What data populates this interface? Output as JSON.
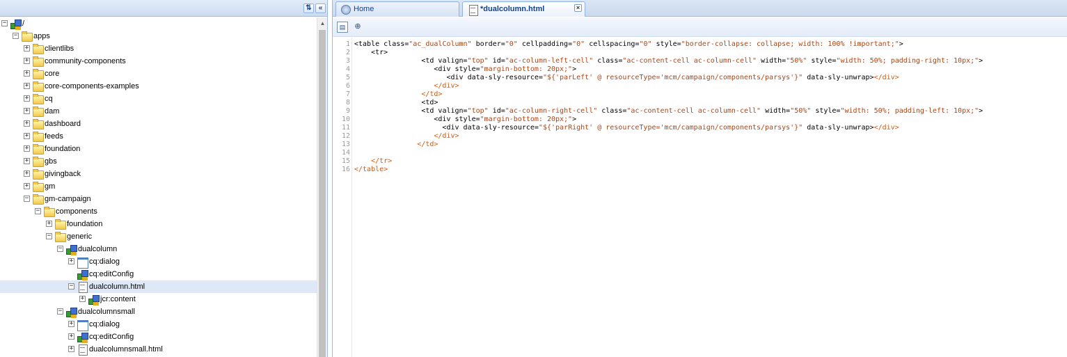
{
  "left_panel": {
    "tools": [
      {
        "icon": "sync-tree-icon"
      },
      {
        "icon": "collapse-panel-icon"
      }
    ],
    "tree": [
      {
        "label": "/",
        "depth": 0,
        "state": "expanded",
        "icon": "component-icon"
      },
      {
        "label": "apps",
        "depth": 1,
        "state": "expanded",
        "icon": "folder-icon"
      },
      {
        "label": "clientlibs",
        "depth": 2,
        "state": "collapsed",
        "icon": "folder-icon"
      },
      {
        "label": "community-components",
        "depth": 2,
        "state": "collapsed",
        "icon": "folder-icon"
      },
      {
        "label": "core",
        "depth": 2,
        "state": "collapsed",
        "icon": "folder-icon"
      },
      {
        "label": "core-components-examples",
        "depth": 2,
        "state": "collapsed",
        "icon": "folder-icon"
      },
      {
        "label": "cq",
        "depth": 2,
        "state": "collapsed",
        "icon": "folder-icon"
      },
      {
        "label": "dam",
        "depth": 2,
        "state": "collapsed",
        "icon": "folder-icon"
      },
      {
        "label": "dashboard",
        "depth": 2,
        "state": "collapsed",
        "icon": "folder-icon"
      },
      {
        "label": "feeds",
        "depth": 2,
        "state": "collapsed",
        "icon": "folder-icon"
      },
      {
        "label": "foundation",
        "depth": 2,
        "state": "collapsed",
        "icon": "folder-icon"
      },
      {
        "label": "gbs",
        "depth": 2,
        "state": "collapsed",
        "icon": "folder-icon"
      },
      {
        "label": "givingback",
        "depth": 2,
        "state": "collapsed",
        "icon": "folder-icon"
      },
      {
        "label": "gm",
        "depth": 2,
        "state": "collapsed",
        "icon": "folder-icon"
      },
      {
        "label": "gm-campaign",
        "depth": 2,
        "state": "expanded",
        "icon": "folder-icon"
      },
      {
        "label": "components",
        "depth": 3,
        "state": "expanded",
        "icon": "folder-icon"
      },
      {
        "label": "foundation",
        "depth": 4,
        "state": "collapsed",
        "icon": "folder-icon"
      },
      {
        "label": "generic",
        "depth": 4,
        "state": "expanded",
        "icon": "folder-icon"
      },
      {
        "label": "dualcolumn",
        "depth": 5,
        "state": "expanded",
        "icon": "component-icon"
      },
      {
        "label": "cq:dialog",
        "depth": 6,
        "state": "collapsed",
        "icon": "dialog-icon"
      },
      {
        "label": "cq:editConfig",
        "depth": 6,
        "state": "none",
        "icon": "component-icon"
      },
      {
        "label": "dualcolumn.html",
        "depth": 6,
        "state": "expanded",
        "icon": "file-icon",
        "selected": true
      },
      {
        "label": "jcr:content",
        "depth": 7,
        "state": "collapsed",
        "icon": "component-icon"
      },
      {
        "label": "dualcolumnsmall",
        "depth": 5,
        "state": "expanded",
        "icon": "component-icon"
      },
      {
        "label": "cq:dialog",
        "depth": 6,
        "state": "collapsed",
        "icon": "dialog-icon"
      },
      {
        "label": "cq:editConfig",
        "depth": 6,
        "state": "collapsed",
        "icon": "component-icon"
      },
      {
        "label": "dualcolumnsmall.html",
        "depth": 6,
        "state": "collapsed",
        "icon": "file-icon"
      }
    ]
  },
  "tabs": [
    {
      "label": "Home",
      "icon": "home-icon",
      "active": false,
      "closable": false
    },
    {
      "label": "*dualcolumn.html",
      "icon": "file-icon",
      "active": true,
      "closable": true
    }
  ],
  "toolbar": {
    "buttons": [
      {
        "name": "save-button",
        "icon": "save-icon",
        "glyph": "💾"
      },
      {
        "name": "find-button",
        "icon": "binoculars-icon",
        "glyph": "🔭"
      }
    ]
  },
  "editor": {
    "lines": [
      [
        [
          "tg",
          "<table "
        ],
        [
          "at",
          "class="
        ],
        [
          "sv",
          "\"ac_dualColumn\""
        ],
        [
          "at",
          " border="
        ],
        [
          "sv",
          "\"0\""
        ],
        [
          "at",
          " cellpadding="
        ],
        [
          "sv",
          "\"0\""
        ],
        [
          "at",
          " cellspacing="
        ],
        [
          "sv",
          "\"0\""
        ],
        [
          "at",
          " style="
        ],
        [
          "sv",
          "\"border-collapse: collapse; width: 100% !important;\""
        ],
        [
          "tg",
          ">"
        ]
      ],
      [
        [
          "tg",
          "    <tr>"
        ]
      ],
      [
        [
          "tg",
          "                <td "
        ],
        [
          "at",
          "valign="
        ],
        [
          "sv",
          "\"top\""
        ],
        [
          "at",
          " id="
        ],
        [
          "sv",
          "\"ac-column-left-cell\""
        ],
        [
          "at",
          " class="
        ],
        [
          "sv",
          "\"ac-content-cell ac-column-cell\""
        ],
        [
          "at",
          " width="
        ],
        [
          "sv",
          "\"50%\""
        ],
        [
          "at",
          " style="
        ],
        [
          "sv",
          "\"width: 50%; padding-right: 10px;\""
        ],
        [
          "tg",
          ">"
        ]
      ],
      [
        [
          "tg",
          "                   <div "
        ],
        [
          "at",
          "style="
        ],
        [
          "sv",
          "\"margin-bottom: 20px;\""
        ],
        [
          "tg",
          ">"
        ]
      ],
      [
        [
          "tg",
          "                      <div "
        ],
        [
          "at",
          "data-sly-resource="
        ],
        [
          "sv",
          "\"${'parLeft' @ resourceType='mcm/campaign/components/parsys'}\""
        ],
        [
          "at",
          " data-sly-unwrap"
        ],
        [
          "tg",
          ">"
        ],
        [
          "ct",
          "</div>"
        ]
      ],
      [
        [
          "ct",
          "                   </div>"
        ]
      ],
      [
        [
          "ct",
          "                </td>"
        ]
      ],
      [
        [
          "tg",
          "                <td>"
        ]
      ],
      [
        [
          "tg",
          "                <td "
        ],
        [
          "at",
          "valign="
        ],
        [
          "sv",
          "\"top\""
        ],
        [
          "at",
          " id="
        ],
        [
          "sv",
          "\"ac-column-right-cell\""
        ],
        [
          "at",
          " class="
        ],
        [
          "sv",
          "\"ac-content-cell ac-column-cell\""
        ],
        [
          "at",
          " width="
        ],
        [
          "sv",
          "\"50%\""
        ],
        [
          "at",
          " style="
        ],
        [
          "sv",
          "\"width: 50%; padding-left: 10px;\""
        ],
        [
          "tg",
          ">"
        ]
      ],
      [
        [
          "tg",
          "                   <div "
        ],
        [
          "at",
          "style="
        ],
        [
          "sv",
          "\"margin-bottom: 20px;\""
        ],
        [
          "tg",
          ">"
        ]
      ],
      [
        [
          "tg",
          "                     <div "
        ],
        [
          "at",
          "data-sly-resource="
        ],
        [
          "sv",
          "\"${'parRight' @ resourceType='mcm/campaign/components/parsys'}\""
        ],
        [
          "at",
          " data-sly-unwrap"
        ],
        [
          "tg",
          ">"
        ],
        [
          "ct",
          "</div>"
        ]
      ],
      [
        [
          "ct",
          "                   </div>"
        ]
      ],
      [
        [
          "ct",
          "               </td>"
        ]
      ],
      [
        [
          "tg",
          ""
        ]
      ],
      [
        [
          "ct",
          "    </tr>"
        ]
      ],
      [
        [
          "ct",
          "</table>"
        ]
      ]
    ]
  },
  "colors": {
    "accent": "#99bbe8",
    "selected_row": "#dfe8f6",
    "string_value": "#b2430f",
    "closing_tag": "#d2590c",
    "tab_text": "#15428b"
  }
}
